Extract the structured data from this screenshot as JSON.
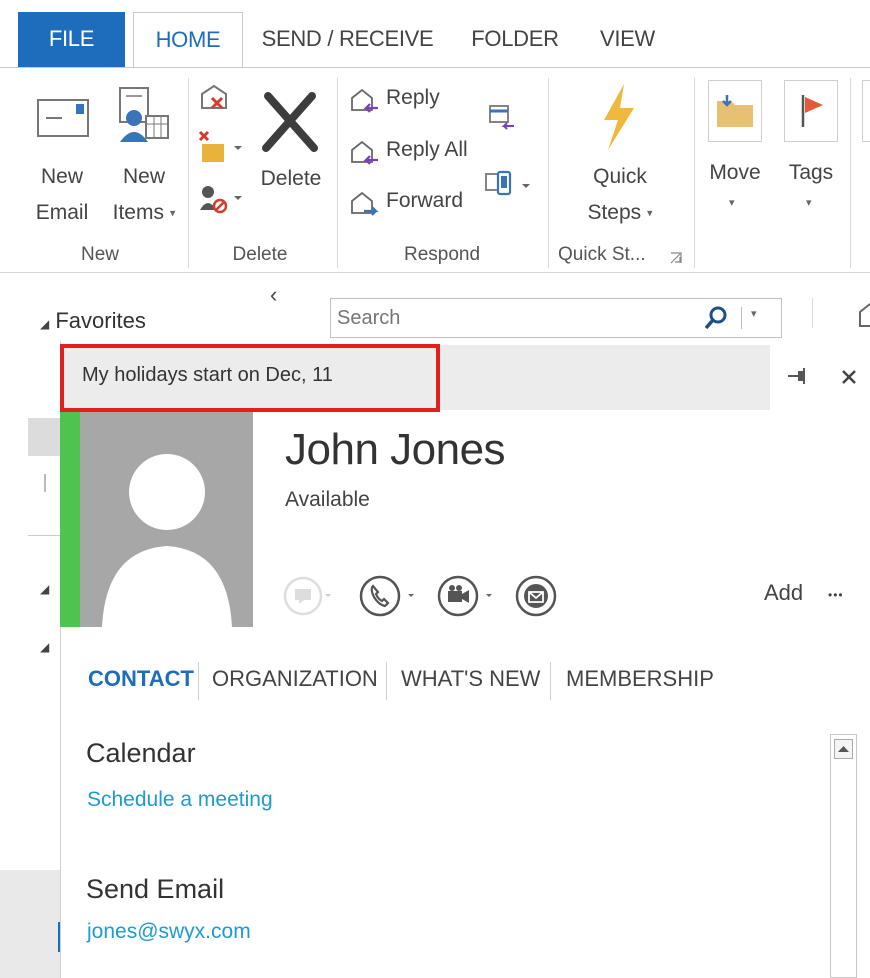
{
  "tabs": {
    "file": "FILE",
    "home": "HOME",
    "send_receive": "SEND / RECEIVE",
    "folder": "FOLDER",
    "view": "VIEW"
  },
  "ribbon": {
    "new_email": [
      "New",
      "Email"
    ],
    "new_items": [
      "New",
      "Items"
    ],
    "delete": "Delete",
    "reply": "Reply",
    "reply_all": "Reply All",
    "forward": "Forward",
    "quick_steps": [
      "Quick",
      "Steps"
    ],
    "move": "Move",
    "tags": "Tags",
    "groups": {
      "new": "New",
      "delete": "Delete",
      "respond": "Respond",
      "quick_steps": "Quick St..."
    }
  },
  "nav": {
    "favorites": "Favorites",
    "collapse": "‹"
  },
  "search": {
    "placeholder": "Search"
  },
  "note": {
    "text": "My holidays start on Dec, 11"
  },
  "contact": {
    "name": "John Jones",
    "status": "Available",
    "add_label": "Add",
    "more_label": "•••",
    "presence_color": "#4fc34f"
  },
  "card_tabs": [
    "CONTACT",
    "ORGANIZATION",
    "WHAT'S NEW",
    "MEMBERSHIP"
  ],
  "sections": {
    "calendar_title": "Calendar",
    "calendar_link": "Schedule a meeting",
    "email_title": "Send Email",
    "email_link": "jones@swyx.com"
  },
  "colors": {
    "accent": "#1e6dbd",
    "link": "#1d9bd1",
    "highlight": "#e02020"
  }
}
